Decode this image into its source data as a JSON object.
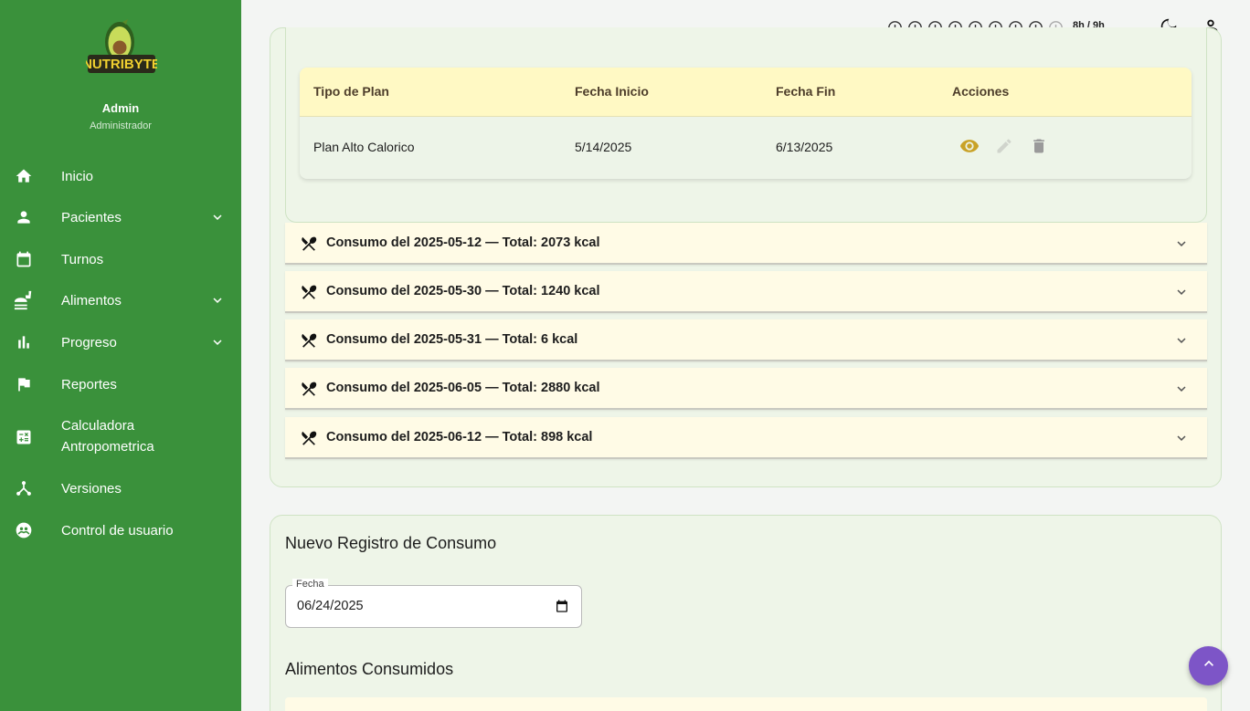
{
  "sidebar": {
    "logo_text": "NUTRIBYTE",
    "user_name": "Admin",
    "user_role": "Administrador",
    "items": [
      {
        "label": "Inicio",
        "icon": "home-icon",
        "expandable": false
      },
      {
        "label": "Pacientes",
        "icon": "person-icon",
        "expandable": true
      },
      {
        "label": "Turnos",
        "icon": "calendar-icon",
        "expandable": false
      },
      {
        "label": "Alimentos",
        "icon": "food-icon",
        "expandable": true
      },
      {
        "label": "Progreso",
        "icon": "bar-chart-icon",
        "expandable": true
      },
      {
        "label": "Reportes",
        "icon": "flag-icon",
        "expandable": false
      },
      {
        "label": "Calculadora Antropometrica",
        "label_line1": "Calculadora",
        "label_line2": "Antropometrica",
        "icon": "calculator-icon",
        "expandable": false
      },
      {
        "label": "Versiones",
        "icon": "merge-icon",
        "expandable": false
      },
      {
        "label": "Control de usuario",
        "icon": "user-control-icon",
        "expandable": false
      }
    ]
  },
  "topbar": {
    "hours_text": "8h / 9h",
    "hours_used": 8,
    "hours_total": 9
  },
  "plans_table": {
    "headers": [
      "Tipo de Plan",
      "Fecha Inicio",
      "Fecha Fin",
      "Acciones"
    ],
    "rows": [
      {
        "tipo": "Plan Alto Calorico",
        "inicio": "5/14/2025",
        "fin": "6/13/2025"
      }
    ]
  },
  "consumos": [
    {
      "title": "Consumo del 2025-05-12 — Total: 2073 kcal"
    },
    {
      "title": "Consumo del 2025-05-30 — Total: 1240 kcal"
    },
    {
      "title": "Consumo del 2025-05-31 — Total: 6 kcal"
    },
    {
      "title": "Consumo del 2025-06-05 — Total: 2880 kcal"
    },
    {
      "title": "Consumo del 2025-06-12 — Total: 898 kcal"
    }
  ],
  "nuevo_registro": {
    "title": "Nuevo Registro de Consumo",
    "fecha_label": "Fecha",
    "fecha_value": "06/24/2025",
    "alimentos_title": "Alimentos Consumidos"
  },
  "colors": {
    "sidebar": "#3a913b",
    "header_yellow": "#fff9c4",
    "accordion": "#fffbe6",
    "eye_icon": "#c9a227",
    "fab": "#7d55c7"
  }
}
